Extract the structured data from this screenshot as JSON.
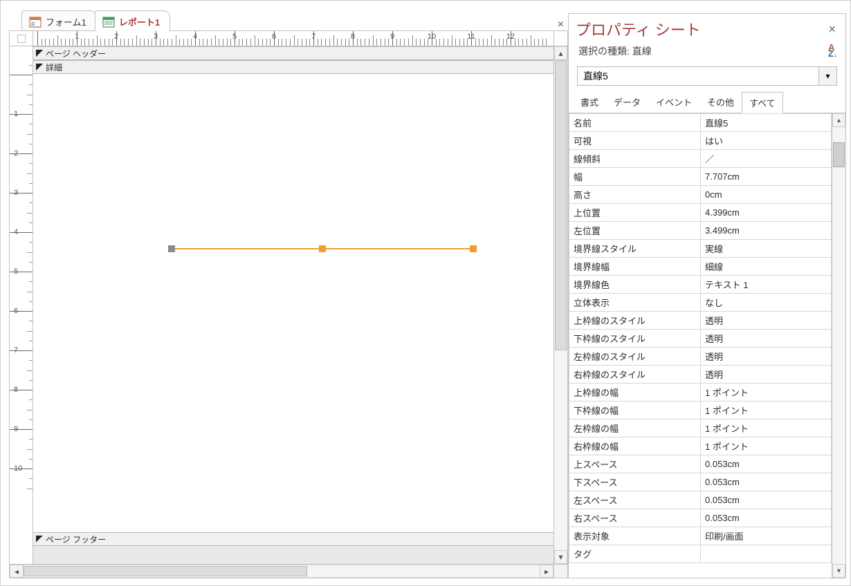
{
  "tabs": [
    {
      "label": "フォーム1"
    },
    {
      "label": "レポート1"
    }
  ],
  "sections": {
    "page_header": "ページ ヘッダー",
    "detail": "詳細",
    "page_footer": "ページ フッター"
  },
  "ruler_h_max": 12,
  "property_sheet": {
    "title": "プロパティ シート",
    "selection_label": "選択の種類: 直線",
    "object": "直線5",
    "tabs": [
      {
        "label": "書式"
      },
      {
        "label": "データ"
      },
      {
        "label": "イベント"
      },
      {
        "label": "その他"
      },
      {
        "label": "すべて"
      }
    ],
    "properties": [
      {
        "k": "名前",
        "v": "直線5"
      },
      {
        "k": "可視",
        "v": "はい"
      },
      {
        "k": "線傾斜",
        "v": "／"
      },
      {
        "k": "幅",
        "v": "7.707cm"
      },
      {
        "k": "高さ",
        "v": "0cm"
      },
      {
        "k": "上位置",
        "v": "4.399cm"
      },
      {
        "k": "左位置",
        "v": "3.499cm"
      },
      {
        "k": "境界線スタイル",
        "v": "実線"
      },
      {
        "k": "境界線幅",
        "v": "細線"
      },
      {
        "k": "境界線色",
        "v": "テキスト 1"
      },
      {
        "k": "立体表示",
        "v": "なし"
      },
      {
        "k": "上枠線のスタイル",
        "v": "透明"
      },
      {
        "k": "下枠線のスタイル",
        "v": "透明"
      },
      {
        "k": "左枠線のスタイル",
        "v": "透明"
      },
      {
        "k": "右枠線のスタイル",
        "v": "透明"
      },
      {
        "k": "上枠線の幅",
        "v": "1 ポイント"
      },
      {
        "k": "下枠線の幅",
        "v": "1 ポイント"
      },
      {
        "k": "左枠線の幅",
        "v": "1 ポイント"
      },
      {
        "k": "右枠線の幅",
        "v": "1 ポイント"
      },
      {
        "k": "上スペース",
        "v": "0.053cm"
      },
      {
        "k": "下スペース",
        "v": "0.053cm"
      },
      {
        "k": "左スペース",
        "v": "0.053cm"
      },
      {
        "k": "右スペース",
        "v": "0.053cm"
      },
      {
        "k": "表示対象",
        "v": "印刷/画面"
      },
      {
        "k": "タグ",
        "v": ""
      }
    ]
  }
}
